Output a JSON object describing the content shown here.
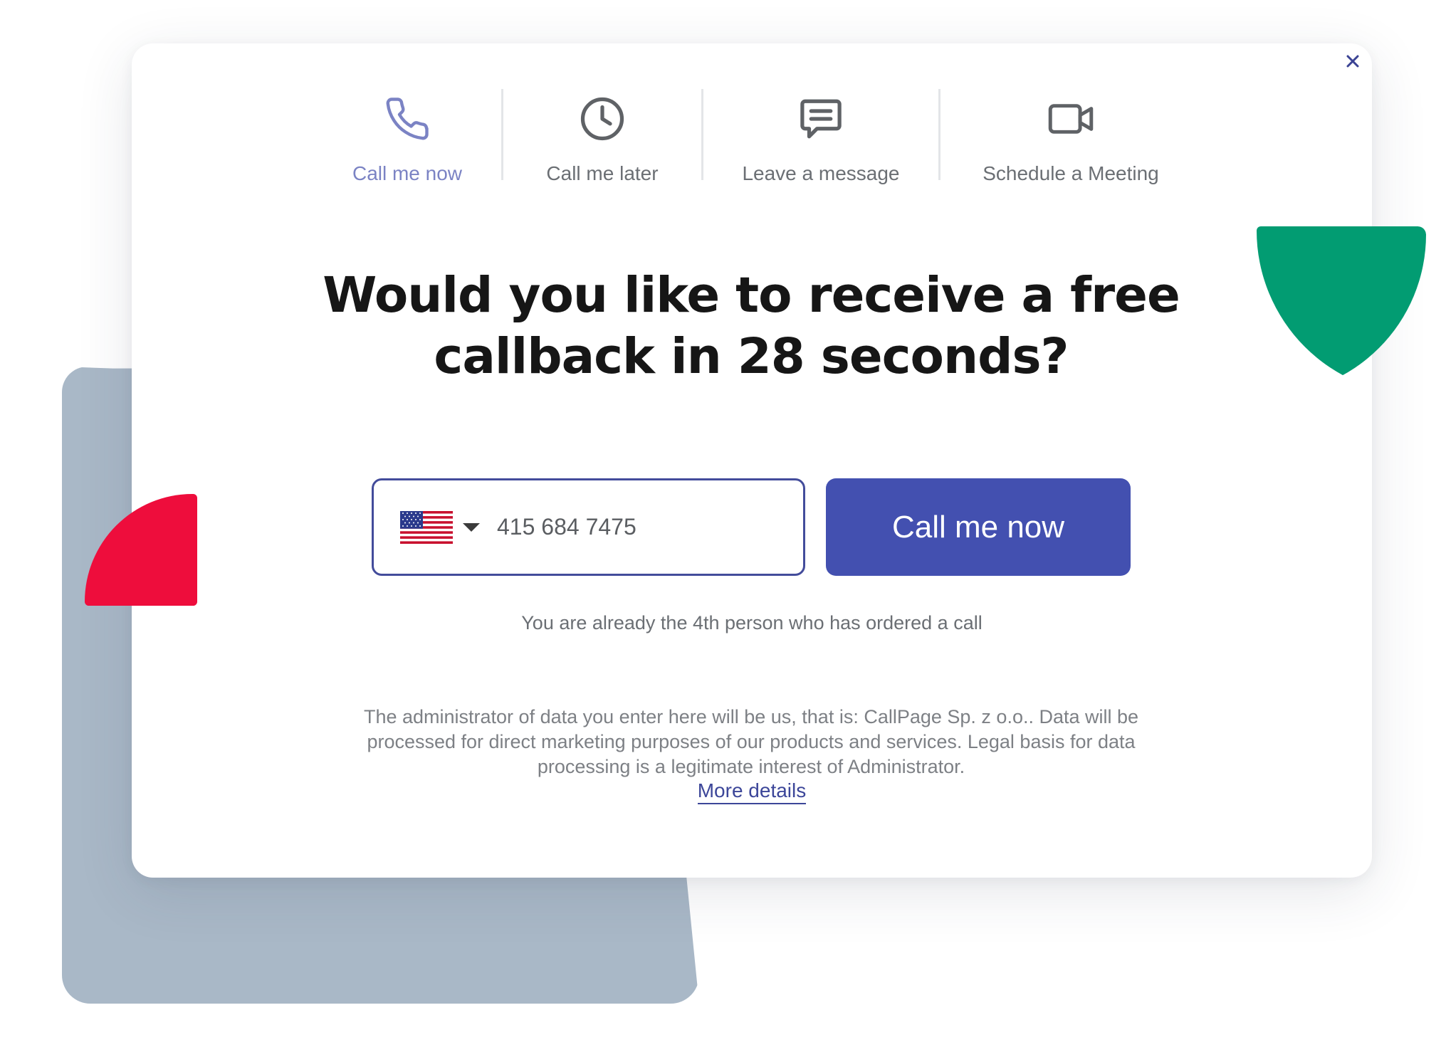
{
  "colors": {
    "accent": "#4350b0",
    "active_tab": "#7b83c4",
    "red_shape": "#ee0d3c",
    "green_shape": "#029c72",
    "slate_shape": "#a9b8c7"
  },
  "dialog": {
    "close_icon": "close-icon"
  },
  "tabs": [
    {
      "label": "Call me now",
      "icon": "phone-icon",
      "active": true
    },
    {
      "label": "Call me later",
      "icon": "clock-icon",
      "active": false
    },
    {
      "label": "Leave a message",
      "icon": "message-icon",
      "active": false
    },
    {
      "label": "Schedule a Meeting",
      "icon": "video-camera-icon",
      "active": false
    }
  ],
  "headline": {
    "line1": "Would you like to receive a free",
    "line2": "callback in 28 seconds?"
  },
  "form": {
    "country_flag": "us-flag-icon",
    "phone_value": "415 684 7475",
    "submit_label": "Call me now"
  },
  "counter_text": "You are already the 4th person who has ordered a call",
  "legal": {
    "line1": "The administrator of data you enter here will be us, that is: CallPage Sp. z o.o.. Data will be",
    "line2": "processed for direct marketing purposes of our products and services. Legal basis for data",
    "line3": "processing is a legitimate interest of Administrator.",
    "more_details": "More details"
  }
}
